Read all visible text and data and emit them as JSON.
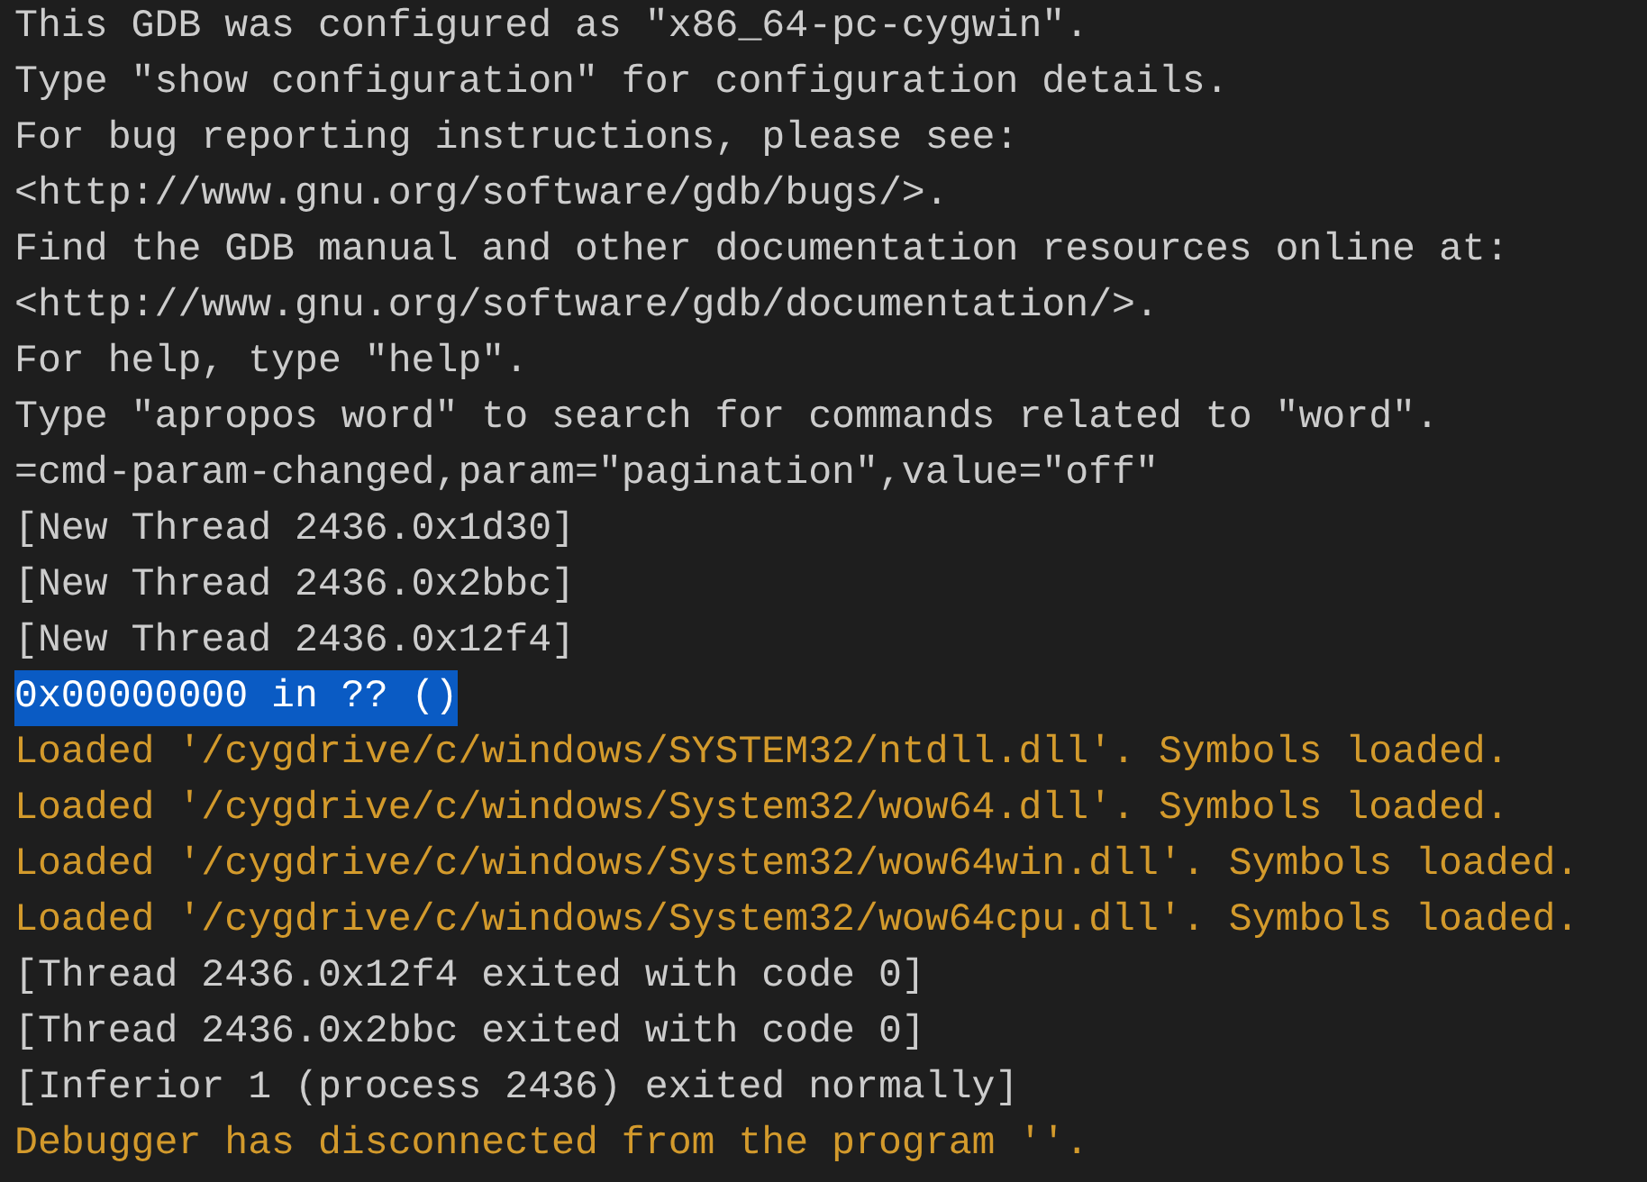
{
  "console": {
    "lines": [
      {
        "text": "This GDB was configured as \"x86_64-pc-cygwin\".",
        "kind": "output",
        "selected": false
      },
      {
        "text": "Type \"show configuration\" for configuration details.",
        "kind": "output",
        "selected": false
      },
      {
        "text": "For bug reporting instructions, please see:",
        "kind": "output",
        "selected": false
      },
      {
        "text": "<http://www.gnu.org/software/gdb/bugs/>.",
        "kind": "output",
        "selected": false
      },
      {
        "text": "Find the GDB manual and other documentation resources online at:",
        "kind": "output",
        "selected": false
      },
      {
        "text": "<http://www.gnu.org/software/gdb/documentation/>.",
        "kind": "output",
        "selected": false
      },
      {
        "text": "For help, type \"help\".",
        "kind": "output",
        "selected": false
      },
      {
        "text": "Type \"apropos word\" to search for commands related to \"word\".",
        "kind": "output",
        "selected": false
      },
      {
        "text": "=cmd-param-changed,param=\"pagination\",value=\"off\"",
        "kind": "output",
        "selected": false
      },
      {
        "text": "[New Thread 2436.0x1d30]",
        "kind": "output",
        "selected": false
      },
      {
        "text": "[New Thread 2436.0x2bbc]",
        "kind": "output",
        "selected": false
      },
      {
        "text": "[New Thread 2436.0x12f4]",
        "kind": "output",
        "selected": false
      },
      {
        "text": "0x00000000 in ?? ()",
        "kind": "output",
        "selected": true
      },
      {
        "text": "Loaded '/cygdrive/c/windows/SYSTEM32/ntdll.dll'. Symbols loaded.",
        "kind": "console",
        "selected": false
      },
      {
        "text": "Loaded '/cygdrive/c/windows/System32/wow64.dll'. Symbols loaded.",
        "kind": "console",
        "selected": false
      },
      {
        "text": "Loaded '/cygdrive/c/windows/System32/wow64win.dll'. Symbols loaded.",
        "kind": "console",
        "selected": false
      },
      {
        "text": "Loaded '/cygdrive/c/windows/System32/wow64cpu.dll'. Symbols loaded.",
        "kind": "console",
        "selected": false
      },
      {
        "text": "[Thread 2436.0x12f4 exited with code 0]",
        "kind": "output",
        "selected": false
      },
      {
        "text": "[Thread 2436.0x2bbc exited with code 0]",
        "kind": "output",
        "selected": false
      },
      {
        "text": "[Inferior 1 (process 2436) exited normally]",
        "kind": "output",
        "selected": false
      },
      {
        "text": "Debugger has disconnected from the program ''.",
        "kind": "console",
        "selected": false
      }
    ]
  }
}
